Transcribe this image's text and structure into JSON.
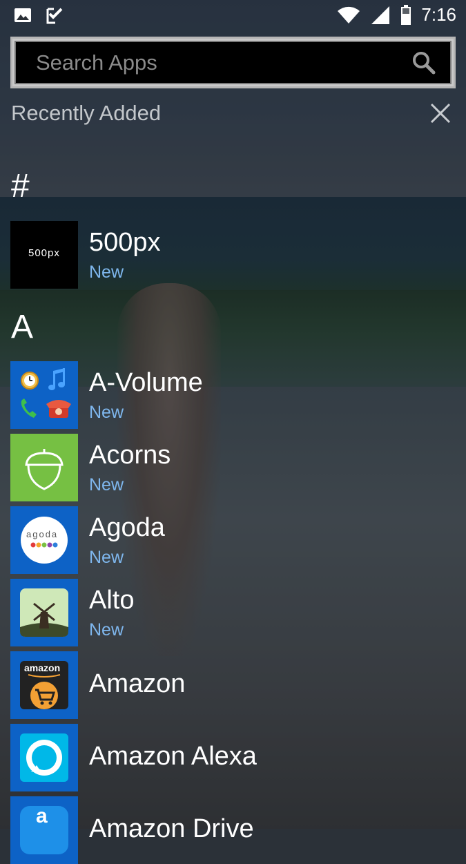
{
  "status_bar": {
    "time": "7:16",
    "left_icons": [
      "image-icon",
      "task-check-icon"
    ],
    "right_icons": [
      "wifi-icon",
      "cell-signal-icon",
      "battery-icon"
    ]
  },
  "search": {
    "placeholder": "Search Apps",
    "value": ""
  },
  "recently_added": {
    "label": "Recently Added"
  },
  "sections": [
    {
      "header": "#"
    },
    {
      "header": "A"
    }
  ],
  "apps": [
    {
      "name": "500px",
      "badge": "New",
      "icon_text": "500px"
    },
    {
      "name": "A-Volume",
      "badge": "New"
    },
    {
      "name": "Acorns",
      "badge": "New"
    },
    {
      "name": "Agoda",
      "badge": "New",
      "icon_text": "agoda"
    },
    {
      "name": "Alto",
      "badge": "New"
    },
    {
      "name": "Amazon",
      "icon_text": "amazon"
    },
    {
      "name": "Amazon Alexa"
    },
    {
      "name": "Amazon Drive",
      "icon_text": "a"
    }
  ],
  "colors": {
    "tile_blue": "#0d62c6",
    "acorns_green": "#76c043",
    "new_badge": "#7fb7ee"
  }
}
